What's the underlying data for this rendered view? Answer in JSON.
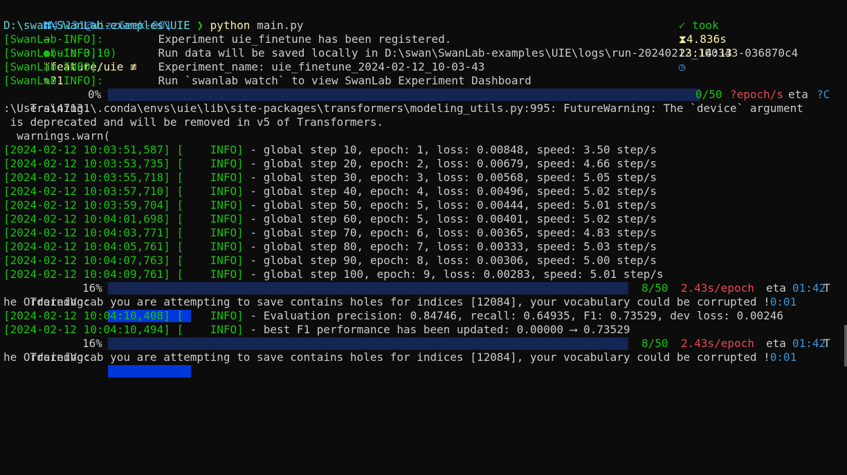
{
  "prompt": {
    "user_host": "47131@WizzGeek-001",
    "arrow": "→",
    "env": "(uie 3.10)",
    "branch": "feature/uie ≢",
    "changes": "?1",
    "took": "✓ took",
    "duration": "4.836s",
    "time": "23:14:13",
    "path": "D:\\swan\\SwanLab-examples\\UIE",
    "chevron": "❯",
    "command": "python",
    "command_arg": "main.py"
  },
  "swanlab": [
    {
      "tag": "[SwanLab-INFO]:",
      "msg": "Experiment uie_finetune has been registered."
    },
    {
      "tag": "[SwanLab-INFO]:",
      "msg": "Run data will be saved locally in D:\\swan\\SwanLab-examples\\UIE\\logs\\run-20240212_100343-036870c4"
    },
    {
      "tag": "[SwanLab-INFO]:",
      "msg": "Experiment_name: uie_finetune_2024-02-12_10-03-43"
    },
    {
      "tag": "[SwanLab-INFO]:",
      "msg": "Run `swanlab watch` to view SwanLab Experiment Dashboard"
    }
  ],
  "progress": [
    {
      "label": "Training:",
      "pct": "0%",
      "fraction": 0.0,
      "count": "0/50",
      "rate": "?epoch/s",
      "eta_label": "eta",
      "eta": "?C"
    },
    {
      "label": "Training:",
      "pct": "16%",
      "fraction": 0.16,
      "count": "8/50",
      "rate": "2.43s/epoch",
      "eta_label": "eta",
      "eta": "01:42",
      "tail": "T"
    },
    {
      "label": "Training:",
      "pct": "16%",
      "fraction": 0.16,
      "count": "8/50",
      "rate": "2.43s/epoch",
      "eta_label": "eta",
      "eta": "01:42",
      "tail": "T"
    }
  ],
  "warning": {
    "line1": ":\\Users\\47131\\.conda\\envs\\uie\\lib\\site-packages\\transformers\\modeling_utils.py:995: FutureWarning: The `device` argument",
    "line2": " is deprecated and will be removed in v5 of Transformers.",
    "line3": "  warnings.warn("
  },
  "logs": [
    {
      "ts": "[2024-02-12 10:03:51,587]",
      "lvl": "[    INFO]",
      "msg": " - global step 10, epoch: 1, loss: 0.00848, speed: 3.50 step/s"
    },
    {
      "ts": "[2024-02-12 10:03:53,735]",
      "lvl": "[    INFO]",
      "msg": " - global step 20, epoch: 2, loss: 0.00679, speed: 4.66 step/s"
    },
    {
      "ts": "[2024-02-12 10:03:55,718]",
      "lvl": "[    INFO]",
      "msg": " - global step 30, epoch: 3, loss: 0.00568, speed: 5.05 step/s"
    },
    {
      "ts": "[2024-02-12 10:03:57,710]",
      "lvl": "[    INFO]",
      "msg": " - global step 40, epoch: 4, loss: 0.00496, speed: 5.02 step/s"
    },
    {
      "ts": "[2024-02-12 10:03:59,704]",
      "lvl": "[    INFO]",
      "msg": " - global step 50, epoch: 5, loss: 0.00444, speed: 5.01 step/s"
    },
    {
      "ts": "[2024-02-12 10:04:01,698]",
      "lvl": "[    INFO]",
      "msg": " - global step 60, epoch: 5, loss: 0.00401, speed: 5.02 step/s"
    },
    {
      "ts": "[2024-02-12 10:04:03,771]",
      "lvl": "[    INFO]",
      "msg": " - global step 70, epoch: 6, loss: 0.00365, speed: 4.83 step/s"
    },
    {
      "ts": "[2024-02-12 10:04:05,761]",
      "lvl": "[    INFO]",
      "msg": " - global step 80, epoch: 7, loss: 0.00333, speed: 5.03 step/s"
    },
    {
      "ts": "[2024-02-12 10:04:07,763]",
      "lvl": "[    INFO]",
      "msg": " - global step 90, epoch: 8, loss: 0.00306, speed: 5.00 step/s"
    },
    {
      "ts": "[2024-02-12 10:04:09,761]",
      "lvl": "[    INFO]",
      "msg": " - global step 100, epoch: 9, loss: 0.00283, speed: 5.01 step/s"
    }
  ],
  "vocab_warning": {
    "text": "he OrderedVocab you are attempting to save contains holes for indices [12084], your vocabulary could be corrupted !",
    "tail": "0:01"
  },
  "eval_logs": [
    {
      "ts": "[2024-02-12 10:04:10,408]",
      "lvl": "[    INFO]",
      "msg": " - Evaluation precision: 0.84746, recall: 0.64935, F1: 0.73529, dev loss: 0.00246"
    },
    {
      "ts": "[2024-02-12 10:04:10,494]",
      "lvl": "[    INFO]",
      "msg": " - best F1 performance has been updated: 0.00000 ⟶ 0.73529"
    }
  ],
  "colors": {
    "background": "#0c0c0c",
    "text": "#cccccc",
    "green": "#16c60c",
    "cyan": "#3a96dd",
    "yellow": "#f9f1a5",
    "red": "#e74856",
    "bar_fill": "#0037da"
  },
  "icons": [
    "windows-icon",
    "python-env-icon",
    "git-branch-icon",
    "edit-icon",
    "hourglass-icon",
    "clock-icon"
  ]
}
